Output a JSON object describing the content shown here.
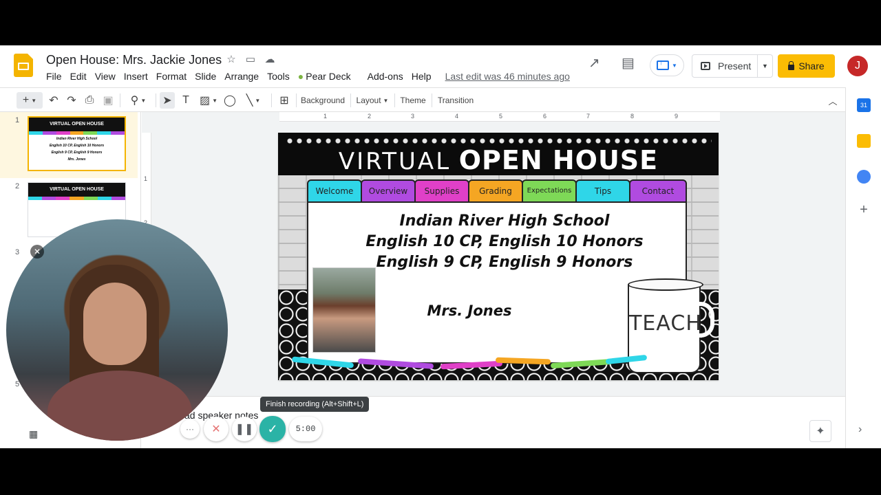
{
  "app": {
    "title": "Open House: Mrs. Jackie Jones",
    "last_edit": "Last edit was 46 minutes ago",
    "avatar_initial": "J",
    "present_label": "Present",
    "share_label": "Share"
  },
  "menu": [
    "File",
    "Edit",
    "View",
    "Insert",
    "Format",
    "Slide",
    "Arrange",
    "Tools",
    "Pear Deck",
    "Add-ons",
    "Help"
  ],
  "toolbar": {
    "background": "Background",
    "layout": "Layout",
    "theme": "Theme",
    "transition": "Transition"
  },
  "ruler": {
    "h": [
      "1",
      "2",
      "3",
      "4",
      "5",
      "6",
      "7",
      "8",
      "9"
    ],
    "v": [
      "1",
      "2"
    ]
  },
  "filmstrip": {
    "slides": [
      "1",
      "2",
      "3",
      "5"
    ],
    "thumb1": {
      "title": "VIRTUAL OPEN HOUSE",
      "lines": [
        "Indian River High School",
        "English 10 CP, English 10 Honors",
        "English 9 CP, English 9 Honors",
        "Mrs. Jones"
      ]
    },
    "thumb2": {
      "title": "VIRTUAL OPEN HOUSE"
    }
  },
  "slide": {
    "title_thin": "VIRTUAL",
    "title_bold": "OPEN HOUSE",
    "tabs": [
      "Welcome",
      "Overview",
      "Supplies",
      "Grading",
      "Expectations",
      "Tips",
      "Contact"
    ],
    "tab_colors": [
      "#2fd6e8",
      "#b04be0",
      "#e040c8",
      "#f5a623",
      "#7ed957",
      "#2fd6e8",
      "#b04be0"
    ],
    "school": "Indian River High School",
    "courses_1": "English 10 CP, English 10 Honors",
    "courses_2": "English 9 CP, English 9 Honors",
    "teacher": "Mrs. Jones",
    "mug": "TEACH"
  },
  "notes": {
    "placeholder": "ad speaker notes"
  },
  "recording": {
    "tooltip": "Finish recording (Alt+Shift+L)",
    "timer": "5:00",
    "more": "···"
  }
}
